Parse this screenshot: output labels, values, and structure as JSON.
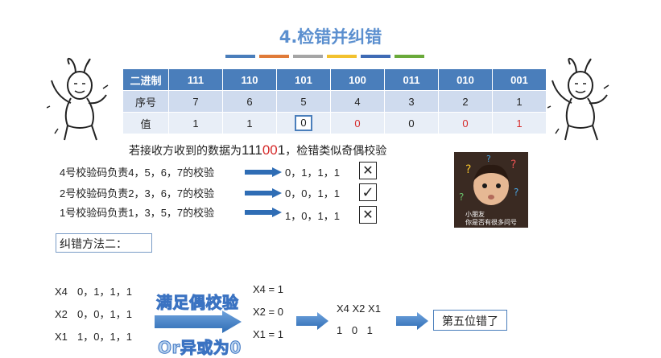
{
  "title": "4.检错并纠错",
  "title_bar_colors": [
    "#4a7ebb",
    "#e07b39",
    "#a5a5a5",
    "#f2c12e",
    "#3f6bb5",
    "#6aaa3a"
  ],
  "table": {
    "row_binary": [
      "二进制",
      "111",
      "110",
      "101",
      "100",
      "011",
      "010",
      "001"
    ],
    "row_index": [
      "序号",
      "7",
      "6",
      "5",
      "4",
      "3",
      "2",
      "1"
    ],
    "row_value": [
      "值",
      "1",
      "1",
      "0",
      "0",
      "0",
      "0",
      "1"
    ]
  },
  "sentence": {
    "prefix": "若接收方收到的数据为",
    "data_black": "111",
    "data_red": "00",
    "data_end": "1",
    "suffix": "，检错类似奇偶校验"
  },
  "checks": [
    {
      "label": "4号校验码负责4，5，6，7的校验",
      "result": "0，1，1，1",
      "mark": "✕"
    },
    {
      "label": "2号校验码负责2，3，6，7的校验",
      "result": "0，0，1，1",
      "mark": "✓"
    },
    {
      "label": "1号校验码负责1，3，5，7的校验",
      "result": "1，0，1，1",
      "mark": "✕"
    }
  ],
  "meme_caption": [
    "小朋友",
    "你是否有很多问号"
  ],
  "method_label": "纠错方法二：",
  "xrows": [
    {
      "name": "X4",
      "vals": "0，1，1，1"
    },
    {
      "name": "X2",
      "vals": "0，0，1，1"
    },
    {
      "name": "X1",
      "vals": "1，0，1，1"
    }
  ],
  "wordart_top": "满足偶校验",
  "wordart_bottom": "Or异或为0",
  "xresults": [
    "X4 = 1",
    "X2 = 0",
    "X1 = 1"
  ],
  "combo_header": "X4 X2 X1",
  "combo_values": "1 0 1",
  "result_text": "第五位错了"
}
